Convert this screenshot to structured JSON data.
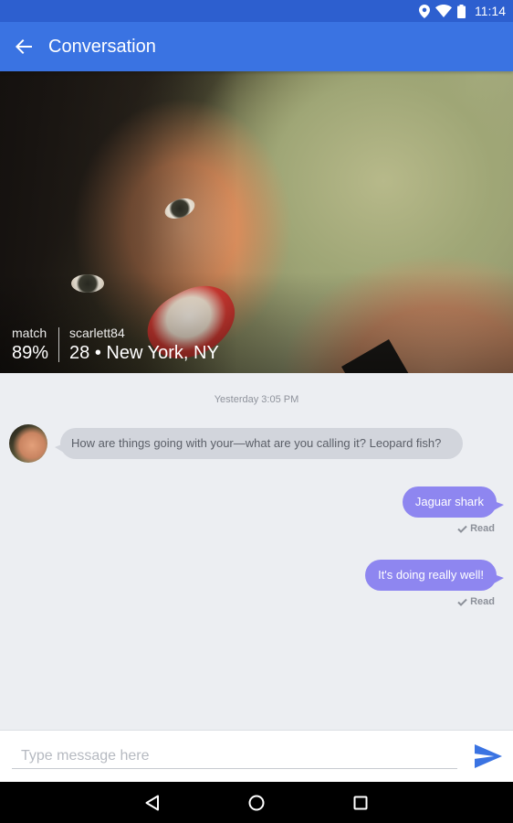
{
  "status_bar": {
    "time": "11:14",
    "icons": [
      "location-icon",
      "wifi-icon",
      "battery-icon"
    ]
  },
  "app_bar": {
    "title": "Conversation",
    "back_icon": "arrow-back-icon",
    "background": "#3a73e2"
  },
  "profile": {
    "match_label": "match",
    "match_value": "89%",
    "username": "scarlett84",
    "details": "28 • New York, NY"
  },
  "chat": {
    "timestamp": "Yesterday 3:05 PM",
    "messages": [
      {
        "direction": "incoming",
        "text": "How are things going with your—what are you calling it? Leopard fish?"
      },
      {
        "direction": "outgoing",
        "text": "Jaguar shark",
        "status": "Read"
      },
      {
        "direction": "outgoing",
        "text": "It's doing really well!",
        "status": "Read"
      }
    ],
    "colors": {
      "incoming_bubble": "#d2d5dc",
      "outgoing_bubble": "#8e86f0"
    }
  },
  "composer": {
    "placeholder": "Type message here",
    "value": "",
    "send_icon": "send-icon",
    "send_color": "#3a73e2"
  },
  "nav_bar": {
    "icons": [
      "back-triangle-icon",
      "home-circle-icon",
      "recents-square-icon"
    ]
  }
}
